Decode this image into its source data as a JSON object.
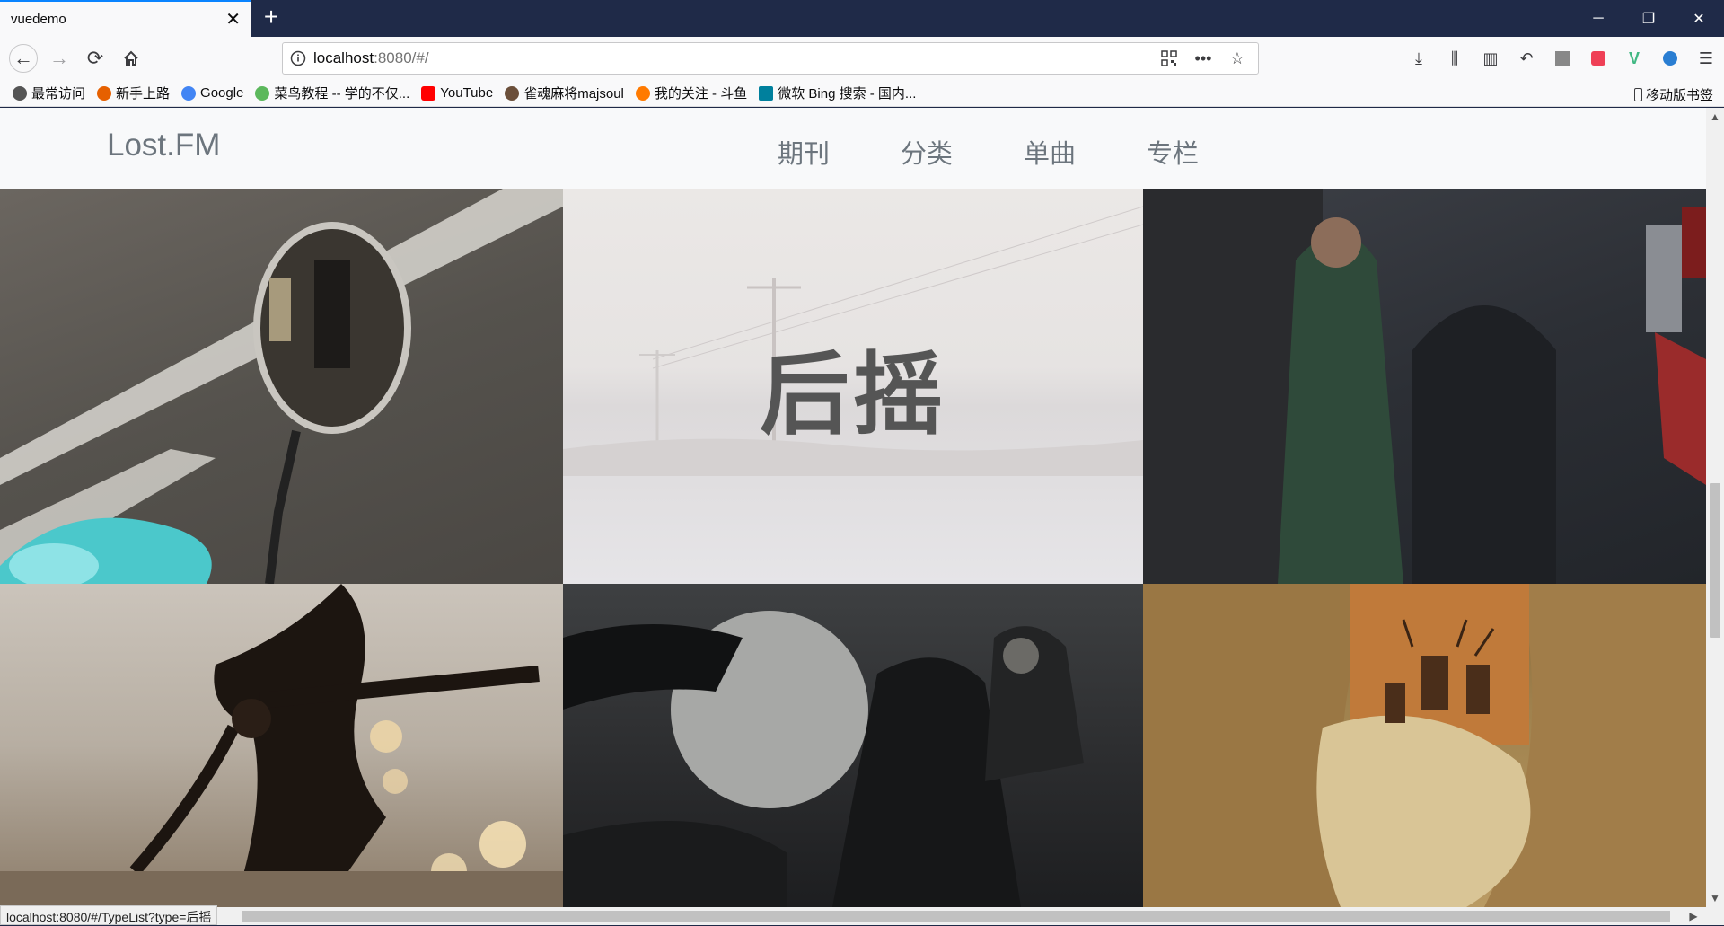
{
  "browser": {
    "tab_title": "vuedemo",
    "url_host": "localhost",
    "url_rest": ":8080/#/",
    "status_url": "localhost:8080/#/TypeList?type=后摇",
    "bookmarks": [
      {
        "label": "最常访问",
        "icon": "gear-icon",
        "color": "#555555"
      },
      {
        "label": "新手上路",
        "icon": "firefox-icon",
        "color": "#e66000"
      },
      {
        "label": "Google",
        "icon": "google-icon",
        "color": "#4285f4"
      },
      {
        "label": "菜鸟教程 -- 学的不仅...",
        "icon": "runoob-icon",
        "color": "#5cb85c"
      },
      {
        "label": "YouTube",
        "icon": "youtube-icon",
        "color": "#ff0000"
      },
      {
        "label": "雀魂麻将majsoul",
        "icon": "majsoul-icon",
        "color": "#6b4f3a"
      },
      {
        "label": "我的关注 - 斗鱼",
        "icon": "douyu-icon",
        "color": "#ff7a00"
      },
      {
        "label": "微软 Bing 搜索 - 国内...",
        "icon": "bing-icon",
        "color": "#00809d"
      }
    ],
    "mobile_bookmarks": "移动版书签"
  },
  "site": {
    "brand": "Lost.FM",
    "nav": [
      "期刊",
      "分类",
      "单曲",
      "专栏"
    ]
  },
  "tiles": [
    {
      "name": "tile-motorcycle-mirror",
      "label": ""
    },
    {
      "name": "tile-post-rock",
      "label": "后摇"
    },
    {
      "name": "tile-knights-castle",
      "label": ""
    },
    {
      "name": "tile-splash-dancers",
      "label": ""
    },
    {
      "name": "tile-dark-rider",
      "label": ""
    },
    {
      "name": "tile-deer-leaf",
      "label": ""
    }
  ]
}
